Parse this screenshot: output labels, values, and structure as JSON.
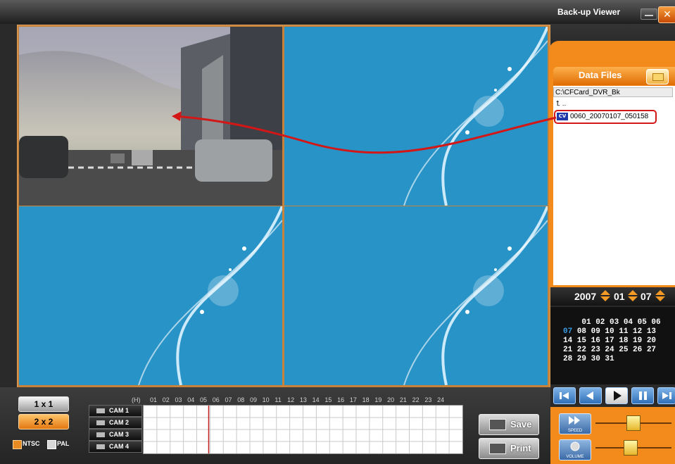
{
  "window": {
    "title": "Back-up Viewer",
    "minimize_icon": "minimize-icon",
    "close_label": "✕"
  },
  "data_files": {
    "title": "Data Files",
    "path": "C:\\CFCard_DVR_Bk",
    "up_label": "..",
    "file_icon_label": "CV",
    "selected_file": "0060_20070107_050158"
  },
  "date": {
    "year": "2007",
    "month": "01",
    "day": "07"
  },
  "calendar": {
    "rows": [
      "    01 02 03 04 05 06",
      "08 09 10 11 12 13",
      "14 15 16 17 18 19 20",
      "21 22 23 24 25 26 27",
      "28 29 30 31"
    ],
    "today": "07"
  },
  "playback": {
    "buttons": [
      "first-frame-icon",
      "rewind-icon",
      "play-icon",
      "pause-icon",
      "last-frame-icon"
    ]
  },
  "speed_label": "SPEED",
  "volume_label": "VOLUME",
  "speed_level": 0.55,
  "volume_level": 0.45,
  "view": {
    "one_label": "1 x 1",
    "four_label": "2 x 2",
    "selected": "2 x 2"
  },
  "signal": {
    "ntsc": "NTSC",
    "pal": "PAL",
    "selected": "NTSC"
  },
  "timeline": {
    "hour_unit": "(H)",
    "hours": [
      "01",
      "02",
      "03",
      "04",
      "05",
      "06",
      "07",
      "08",
      "09",
      "10",
      "11",
      "12",
      "13",
      "14",
      "15",
      "16",
      "17",
      "18",
      "19",
      "20",
      "21",
      "22",
      "23",
      "24"
    ],
    "cams": [
      "CAM 1",
      "CAM 2",
      "CAM 3",
      "CAM 4"
    ],
    "cursor_hour": 5
  },
  "actions": {
    "save": "Save",
    "print": "Print"
  },
  "colors": {
    "accent": "#f28a1c",
    "arrow": "#d31616",
    "video_bg": "#1f8cbf"
  }
}
